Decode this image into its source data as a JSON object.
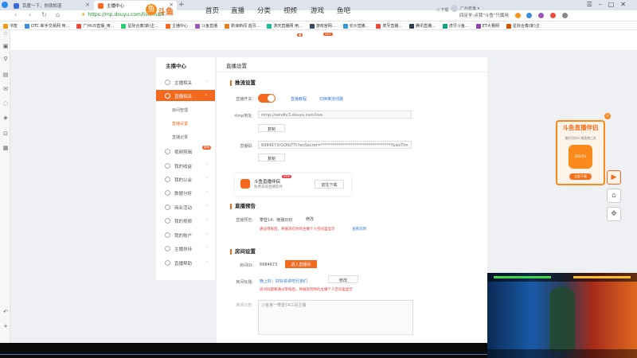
{
  "tabs": [
    {
      "title": "百度一下，你就知道"
    },
    {
      "title": "主播中心"
    }
  ],
  "address": {
    "url": "https://mp.douyu.com/live/main"
  },
  "toolbar_right": {
    "hint": "四足羊:点我\"斗鱼\"只属用"
  },
  "bookmarks": [
    "书签",
    "OTC:新手交易网 用...",
    "广州US直播_用...",
    "星际合奏(斯)主...",
    "主播中心",
    "斗鱼直播",
    "新浪新闻 首页...",
    "游天直播网 用...",
    "游戏官网...",
    "长沙直播...",
    "虎牙直播...",
    "腾讯直播...",
    "虎牙斗鱼...",
    "ET大赛网",
    "星际合奏(斯)主"
  ],
  "header": {
    "logo_text": "斗鱼",
    "logo_sub": "DOUYU.COM",
    "nav": [
      "首页",
      "直播",
      "分类",
      "视频",
      "游戏",
      "鱼吧"
    ],
    "download": "下载",
    "user": "广州老鬼"
  },
  "sidebar": {
    "title": "主播中心",
    "items": [
      {
        "label": "主播相关",
        "active": false
      },
      {
        "label": "直播相关",
        "active": true
      },
      {
        "label": "房间管理",
        "sub": true
      },
      {
        "label": "直播设置",
        "sub": true,
        "selected": true
      },
      {
        "label": "直播记录",
        "sub": true
      },
      {
        "label": "视频剪辑",
        "badge": "新版"
      },
      {
        "label": "我的收益"
      },
      {
        "label": "我的公会"
      },
      {
        "label": "数据分析"
      },
      {
        "label": "商业活动"
      },
      {
        "label": "我的视频"
      },
      {
        "label": "我的账户"
      },
      {
        "label": "主播扶持"
      },
      {
        "label": "直播帮助"
      }
    ]
  },
  "main": {
    "title": "直播设置",
    "push": {
      "section": "推流设置",
      "switch_label": "直播开关:",
      "btn_tutorial": "直播教程",
      "btn_restart": "切换推流线路",
      "rtmp_label": "rtmp地址:",
      "rtmp_value": "rtmp://sendtc3.douyu.com/live",
      "copy": "复制",
      "code_label": "直播码:",
      "code_value": "6984673rGOtbTTt?wsSecret=************************************&wsTim",
      "copy2": "复制"
    },
    "promo": {
      "title": "斗鱼直播伴侣",
      "subtitle": "免费高效直播软件",
      "new": "NEW",
      "download": "前往下载"
    },
    "preview": {
      "section": "直播预告",
      "label": "直播预告:",
      "value": "攀登14：晚播玩玩",
      "edit": "修改",
      "warn": "通过审核后，将展现在你的主播个人空间里显示",
      "link": "查看说明"
    },
    "room": {
      "section": "房间设置",
      "id_label": "房间ID:",
      "id_value": "6984673",
      "enter": "进入直播间",
      "title_label": "房间标题:",
      "title_value": "晚上好，好好讲讲吧兄弟们",
      "edit": "修改",
      "warn": "房间标题要通过审核后，将展现到你的主播个人空间里显示",
      "notice_label": "房间公告:",
      "notice_value": "斗鱼第一攀登14三哥主播"
    }
  },
  "ad": {
    "title": "斗鱼直播伴侣",
    "desc": "最好用的PC端直播工具",
    "app": "DOUYU",
    "go": "立即下载"
  },
  "colors": {
    "accent": "#f5691e",
    "link": "#3a7bd5",
    "warn": "#e4393c"
  }
}
